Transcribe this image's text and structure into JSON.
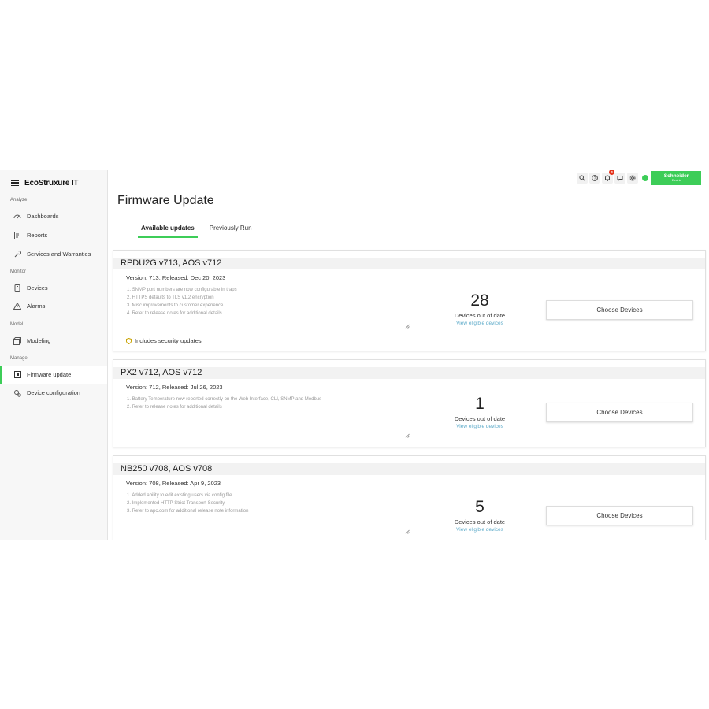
{
  "app": {
    "name": "EcoStruxure IT"
  },
  "sidebar": {
    "sections": [
      {
        "label": "Analyze",
        "items": [
          {
            "label": "Dashboards",
            "icon": "dashboard-icon"
          },
          {
            "label": "Reports",
            "icon": "report-icon"
          },
          {
            "label": "Services and Warranties",
            "icon": "wrench-icon"
          }
        ]
      },
      {
        "label": "Monitor",
        "items": [
          {
            "label": "Devices",
            "icon": "device-icon"
          },
          {
            "label": "Alarms",
            "icon": "alarm-icon"
          }
        ]
      },
      {
        "label": "Model",
        "items": [
          {
            "label": "Modeling",
            "icon": "cube-icon"
          }
        ]
      },
      {
        "label": "Manage",
        "items": [
          {
            "label": "Firmware update",
            "icon": "firmware-icon",
            "active": true
          },
          {
            "label": "Device configuration",
            "icon": "gears-icon"
          }
        ]
      }
    ]
  },
  "topbar": {
    "notification_count": "3",
    "brand": "Schneider",
    "brand_sub": "Electric",
    "accent": "#3dcd58"
  },
  "main": {
    "title": "Firmware Update",
    "tabs": [
      {
        "label": "Available updates",
        "active": true
      },
      {
        "label": "Previously Run",
        "active": false
      }
    ],
    "updates": [
      {
        "name": "RPDU2G v713, AOS v712",
        "version": "Version: 713, Released: Dec 20, 2023",
        "notes": [
          "1. SNMP port numbers are now configurable in traps",
          "2. HTTPS defaults to TLS v1.2 encryption",
          "3. Misc improvements to customer experience",
          "4. Refer to release notes for additional details"
        ],
        "security": "Includes security updates",
        "count": "28",
        "count_label": "Devices out of date",
        "link": "View eligible devices",
        "button": "Choose Devices"
      },
      {
        "name": "PX2 v712, AOS v712",
        "version": "Version: 712, Released: Jul 26, 2023",
        "notes": [
          "1. Battery Temperature now reported correctly on the Web Interface, CLI, SNMP and Modbus",
          "2. Refer to release notes for additional details"
        ],
        "count": "1",
        "count_label": "Devices out of date",
        "link": "View eligible devices",
        "button": "Choose Devices"
      },
      {
        "name": "NB250 v708, AOS v708",
        "version": "Version: 708, Released: Apr 9, 2023",
        "notes": [
          "1. Added ability to edit existing users via config file",
          "2. Implemented HTTP Strict Transport Security",
          "3. Refer to apc.com for additional release note information"
        ],
        "count": "5",
        "count_label": "Devices out of date",
        "link": "View eligible devices",
        "button": "Choose Devices"
      }
    ]
  }
}
